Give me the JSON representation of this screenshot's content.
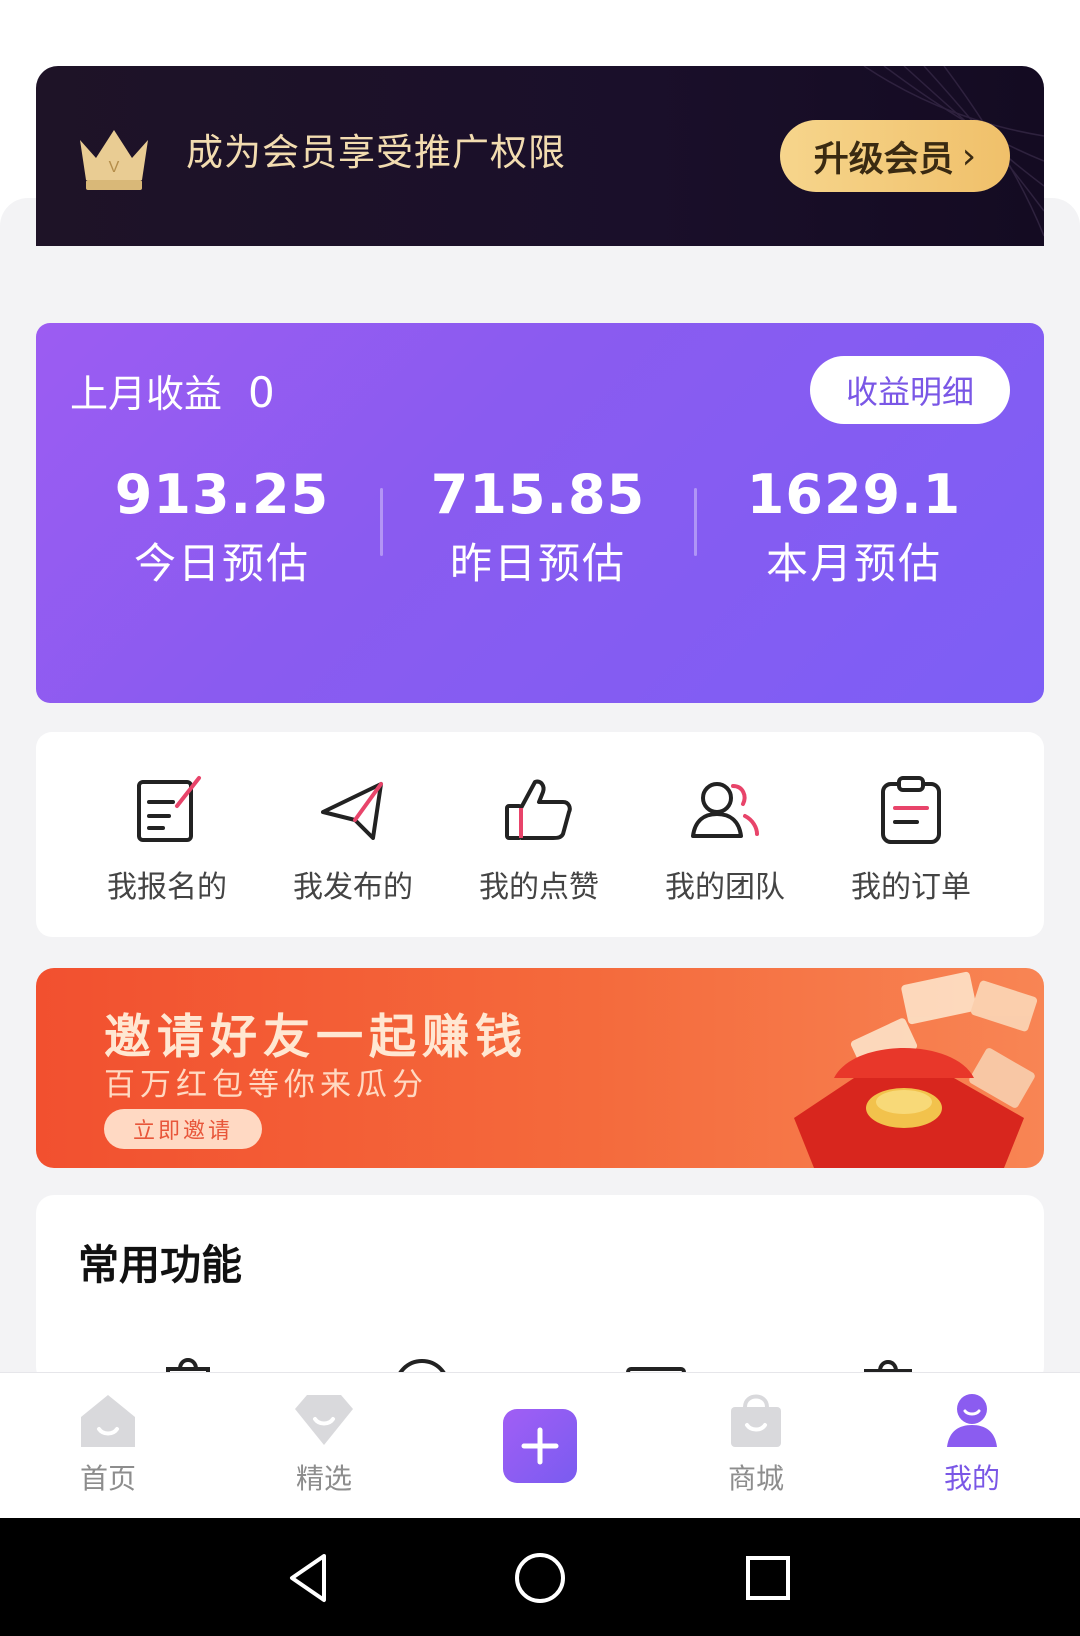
{
  "vip_banner": {
    "text": "成为会员享受推广权限",
    "upgrade_label": "升级会员",
    "chevron": "›"
  },
  "earnings": {
    "last_month_label": "上月收益",
    "last_month_value": "0",
    "detail_button": "收益明细",
    "stats": [
      {
        "value": "913.25",
        "label": "今日预估"
      },
      {
        "value": "715.85",
        "label": "昨日预估"
      },
      {
        "value": "1629.1",
        "label": "本月预估"
      }
    ]
  },
  "shortcuts": [
    {
      "label": "我报名的",
      "icon": "signup-edit-icon"
    },
    {
      "label": "我发布的",
      "icon": "paper-plane-icon"
    },
    {
      "label": "我的点赞",
      "icon": "thumbs-up-icon"
    },
    {
      "label": "我的团队",
      "icon": "team-icon"
    },
    {
      "label": "我的订单",
      "icon": "order-clipboard-icon"
    }
  ],
  "invite_banner": {
    "title": "邀请好友一起赚钱",
    "subtitle": "百万红包等你来瓜分",
    "button": "立即邀请"
  },
  "common_functions": {
    "title": "常用功能"
  },
  "bottom_nav": {
    "items": [
      {
        "label": "首页",
        "icon": "home-icon",
        "active": false
      },
      {
        "label": "精选",
        "icon": "gem-icon",
        "active": false
      },
      {
        "label": "",
        "icon": "plus-icon",
        "active": false
      },
      {
        "label": "商城",
        "icon": "shopping-bag-icon",
        "active": false
      },
      {
        "label": "我的",
        "icon": "user-icon",
        "active": true
      }
    ]
  },
  "colors": {
    "accent_purple": "#7a57e6",
    "vip_gold": "#f0c06a",
    "invite_orange": "#f2502f"
  }
}
